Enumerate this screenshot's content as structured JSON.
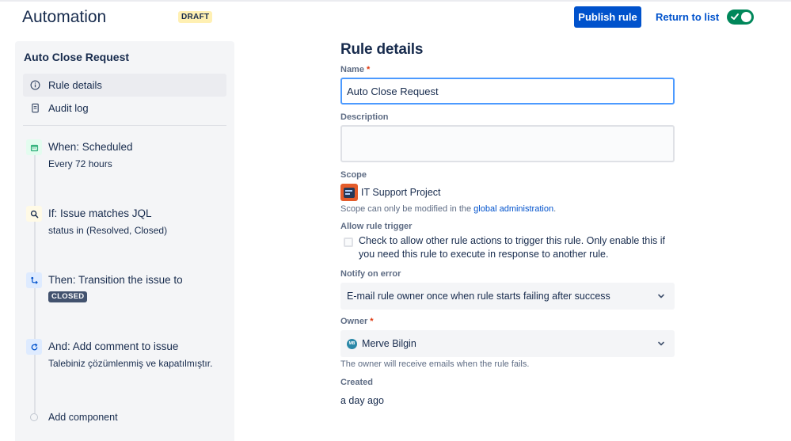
{
  "header": {
    "app_title": "Automation",
    "status_badge": "DRAFT",
    "publish_label": "Publish rule",
    "return_label": "Return to list",
    "toggle_enabled": true
  },
  "sidebar": {
    "rule_name": "Auto Close Request",
    "nav": [
      {
        "label": "Rule details",
        "icon": "info-icon",
        "active": true
      },
      {
        "label": "Audit log",
        "icon": "document-icon",
        "active": false
      }
    ],
    "steps": [
      {
        "title": "When: Scheduled",
        "detail": "Every 72 hours",
        "icon": "calendar-icon",
        "color": "#36b37e"
      },
      {
        "title": "If: Issue matches JQL",
        "detail": "status in (Resolved, Closed)",
        "icon": "search-icon",
        "color": "#ffab00"
      },
      {
        "title": "Then: Transition the issue to",
        "lozenge": "CLOSED",
        "icon": "transition-icon",
        "color": "#0052cc"
      },
      {
        "title": "And: Add comment to issue",
        "detail": "Talebiniz çözümlenmiş ve kapatılmıştır.",
        "icon": "refresh-icon",
        "color": "#0052cc"
      }
    ],
    "add_component": "Add component"
  },
  "main": {
    "heading": "Rule details",
    "name_label": "Name",
    "name_value": "Auto Close Request",
    "description_label": "Description",
    "description_value": "",
    "scope_label": "Scope",
    "scope_project": "IT Support Project",
    "scope_hint_prefix": "Scope can only be modified in the",
    "scope_hint_link": "global administration",
    "scope_hint_suffix": ".",
    "trigger_label": "Allow rule trigger",
    "trigger_text": "Check to allow other rule actions to trigger this rule. Only enable this if you need this rule to execute in response to another rule.",
    "trigger_checked": false,
    "notify_label": "Notify on error",
    "notify_value": "E-mail rule owner once when rule starts failing after success",
    "owner_label": "Owner",
    "owner_value": "Merve Bilgin",
    "owner_hint": "The owner will receive emails when the rule fails.",
    "created_label": "Created",
    "created_value": "a day ago"
  },
  "colors": {
    "primary": "#0052cc",
    "toggle_on": "#00875a",
    "draft_badge": "#fff0b3",
    "required": "#de350b"
  }
}
